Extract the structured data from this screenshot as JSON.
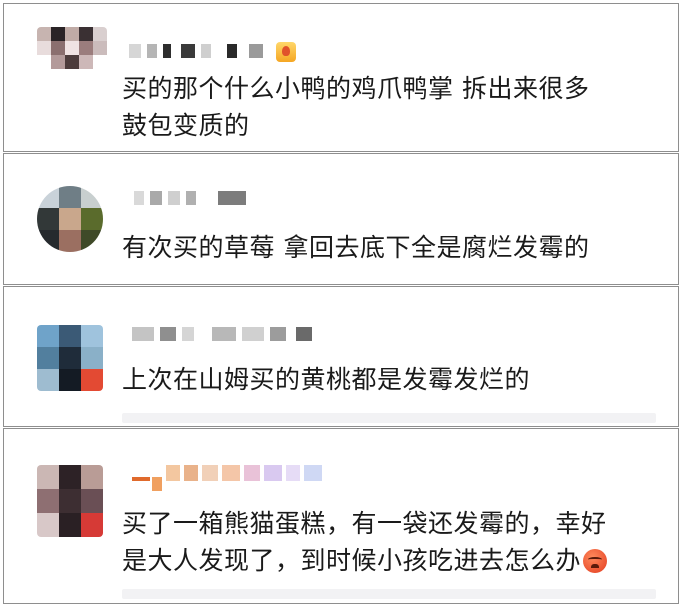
{
  "comments": [
    {
      "text_lines": [
        "买的那个什么小鸭的鸡爪鸭掌 拆出来很多",
        "鼓包变质的"
      ]
    },
    {
      "text_lines": [
        "有次买的草莓 拿回去底下全是腐烂发霉的"
      ]
    },
    {
      "text_lines": [
        "上次在山姆买的黄桃都是发霉发烂的"
      ]
    },
    {
      "text_lines": [
        "买了一箱熊猫蛋糕，有一袋还发霉的，幸好",
        "是大人发现了，到时候小孩吃进去怎么办"
      ],
      "trailing_emoji": "angry-face-emoji"
    }
  ],
  "colors": {
    "border": "#8e8e8e",
    "text": "#1a1a1a",
    "reply_bar": "#f2f2f4",
    "name_blur": "#cfcfcf"
  }
}
